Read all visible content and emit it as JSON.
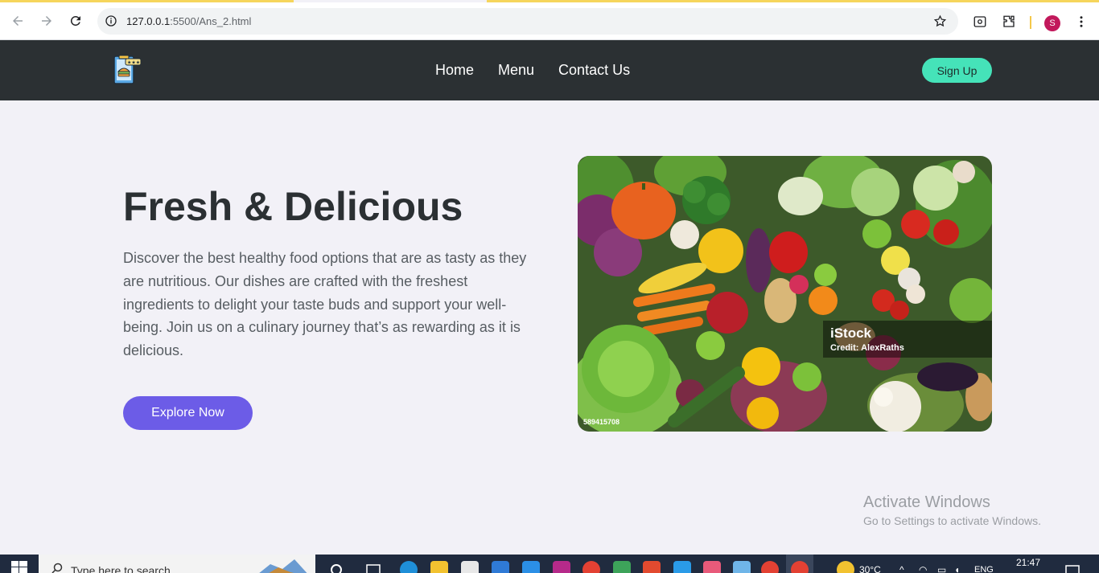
{
  "browser": {
    "url_host": "127.0.0.1",
    "url_path": ":5500/Ans_2.html",
    "profile_initial": "S",
    "icons": [
      "back-arrow-icon",
      "forward-arrow-icon",
      "reload-icon",
      "site-info-icon",
      "bookmark-star-icon",
      "screenshot-icon",
      "extensions-icon",
      "menu-dots-icon"
    ]
  },
  "header": {
    "logo": "food-rating-logo",
    "nav": [
      "Home",
      "Menu",
      "Contact Us"
    ],
    "signup_label": "Sign Up"
  },
  "hero": {
    "title": "Fresh & Delicious",
    "text": "Discover the best healthy food options that are as tasty as they are nutritious. Our dishes are crafted with the freshest ingredients to delight your taste buds and support your well-being. Join us on a culinary journey that’s as rewarding as it is delicious.",
    "cta_label": "Explore Now",
    "image": {
      "brand": "iStock",
      "credit": "Credit: AlexRaths",
      "id": "589415708"
    }
  },
  "watermark": {
    "title": "Activate Windows",
    "subtitle": "Go to Settings to activate Windows."
  },
  "taskbar": {
    "search_placeholder": "Type here to search",
    "temperature": "30°C",
    "language": "ENG",
    "time": "21:47"
  },
  "colors": {
    "header_bg": "#2b3033",
    "signup_bg": "#45e3b9",
    "cta_bg": "#6c5ce7",
    "page_bg": "#f2f1f7",
    "title_color": "#2b3033"
  }
}
